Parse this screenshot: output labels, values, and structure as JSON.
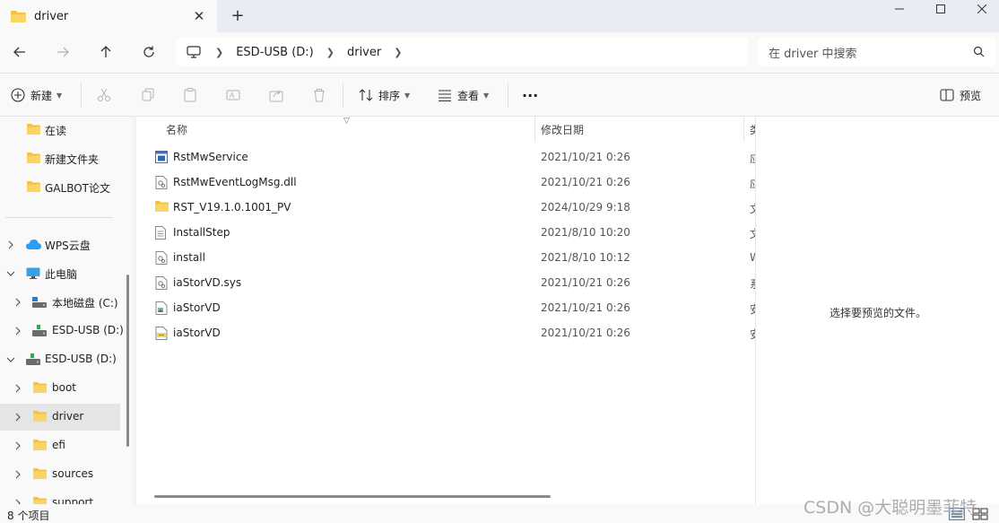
{
  "tab": {
    "title": "driver"
  },
  "address": {
    "segments": [
      "ESD-USB (D:)",
      "driver"
    ]
  },
  "search": {
    "placeholder": "在 driver 中搜索"
  },
  "commands": {
    "new_label": "新建",
    "sort_label": "排序",
    "view_label": "查看",
    "more_label": "···",
    "preview_label": "预览"
  },
  "nav": {
    "quick": [
      "在读",
      "新建文件夹",
      "GALBOT论文"
    ],
    "wps_cloud": "WPS云盘",
    "this_pc": "此电脑",
    "local_disk": "本地磁盘 (C:)",
    "esd_usb_collapsed": "ESD-USB (D:)",
    "esd_usb_expanded": "ESD-USB (D:)",
    "folders": [
      "boot",
      "driver",
      "efi",
      "sources",
      "support"
    ]
  },
  "columns": {
    "name": "名称",
    "date": "修改日期",
    "type": "类"
  },
  "files": [
    {
      "name": "RstMwService",
      "date": "2021/10/21 0:26",
      "type": "应",
      "icon": "app-icon"
    },
    {
      "name": "RstMwEventLogMsg.dll",
      "date": "2021/10/21 0:26",
      "type": "应",
      "icon": "dll-icon"
    },
    {
      "name": "RST_V19.1.0.1001_PV",
      "date": "2024/10/29 9:18",
      "type": "文",
      "icon": "folder-icon"
    },
    {
      "name": "InstallStep",
      "date": "2021/8/10 10:20",
      "type": "文",
      "icon": "text-file-icon"
    },
    {
      "name": "install",
      "date": "2021/8/10 10:12",
      "type": "W",
      "icon": "script-icon"
    },
    {
      "name": "iaStorVD.sys",
      "date": "2021/10/21 0:26",
      "type": "系",
      "icon": "sys-icon"
    },
    {
      "name": "iaStorVD",
      "date": "2021/10/21 0:26",
      "type": "安",
      "icon": "catalog-icon"
    },
    {
      "name": "iaStorVD",
      "date": "2021/10/21 0:26",
      "type": "安",
      "icon": "inf-icon"
    }
  ],
  "preview": {
    "message": "选择要预览的文件。"
  },
  "status": {
    "count": "8 个项目"
  },
  "watermark": "CSDN @大聪明墨菲特",
  "colors": {
    "folder": "#f4c23e",
    "accent": "#0067c0"
  }
}
